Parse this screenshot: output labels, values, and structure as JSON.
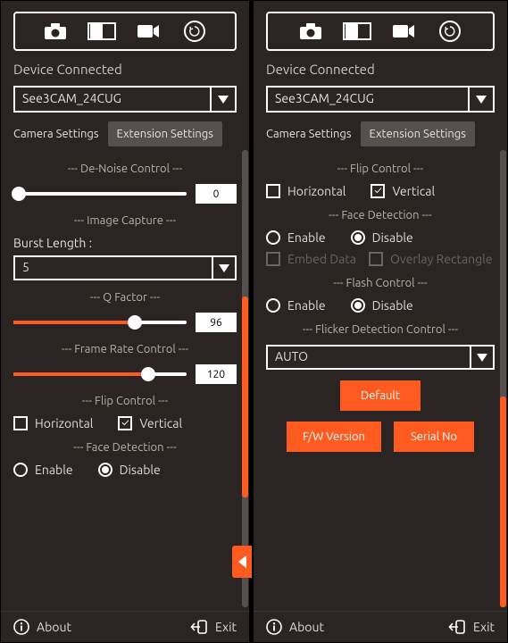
{
  "status": "Device Connected",
  "device": "See3CAM_24CUG",
  "tabs": {
    "camera": "Camera Settings",
    "extension": "Extension Settings"
  },
  "footer": {
    "about": "About",
    "exit": "Exit"
  },
  "left": {
    "denoise": {
      "title": "--- De-Noise Control ---",
      "value": "0",
      "pct": 0
    },
    "imgcap": {
      "title": "--- Image Capture ---"
    },
    "burst": {
      "label": "Burst Length :",
      "value": "5"
    },
    "qfactor": {
      "title": "--- Q Factor ---",
      "value": "96",
      "pct": 70
    },
    "framerate": {
      "title": "--- Frame Rate Control ---",
      "value": "120",
      "pct": 78
    },
    "flip": {
      "title": "--- Flip Control ---",
      "h": "Horizontal",
      "v": "Vertical"
    },
    "face": {
      "title": "--- Face Detection ---",
      "enable": "Enable",
      "disable": "Disable"
    }
  },
  "right": {
    "flip": {
      "title": "--- Flip Control ---",
      "h": "Horizontal",
      "v": "Vertical"
    },
    "face": {
      "title": "--- Face Detection ---",
      "enable": "Enable",
      "disable": "Disable",
      "embed": "Embed Data",
      "overlay": "Overlay Rectangle"
    },
    "flash": {
      "title": "--- Flash Control ---",
      "enable": "Enable",
      "disable": "Disable"
    },
    "flicker": {
      "title": "--- Flicker Detection Control ---",
      "value": "AUTO"
    },
    "buttons": {
      "default": "Default",
      "fw": "F/W Version",
      "serial": "Serial No"
    }
  }
}
